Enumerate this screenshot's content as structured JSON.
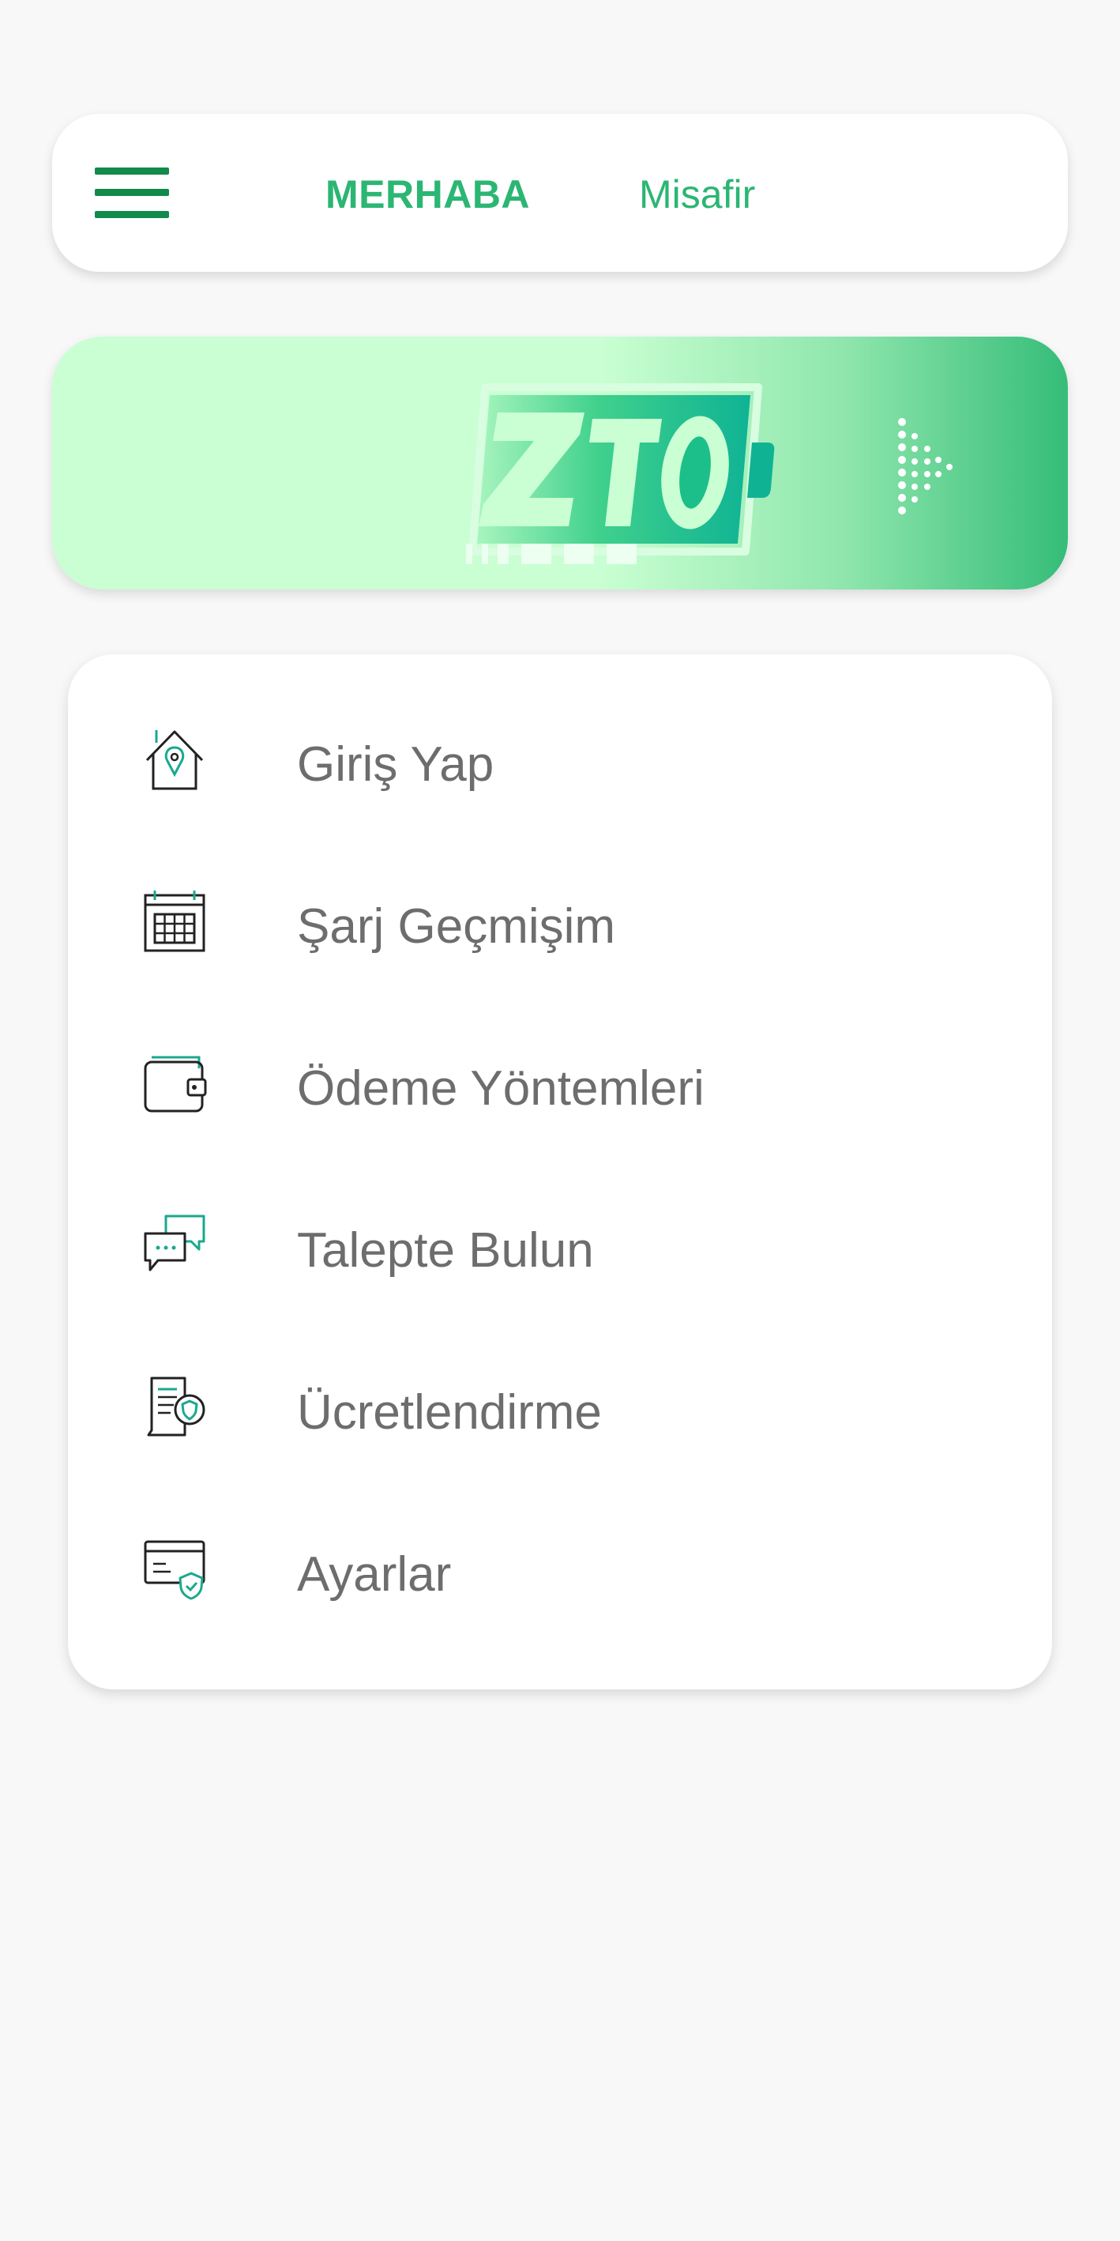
{
  "header": {
    "greeting": "MERHABA",
    "user_name": "Misafir"
  },
  "banner": {
    "logo_icon": "zto-battery-logo",
    "arrow_icon": "dotted-arrow-icon"
  },
  "colors": {
    "accent": "#2bb673",
    "accent_dark": "#118a4a",
    "icon_teal": "#1aa88e",
    "text": "#6d6d6d"
  },
  "menu": {
    "items": [
      {
        "label": "Giriş Yap",
        "icon": "home-location-icon"
      },
      {
        "label": "Şarj Geçmişim",
        "icon": "calendar-icon"
      },
      {
        "label": "Ödeme Yöntemleri",
        "icon": "wallet-icon"
      },
      {
        "label": "Talepte Bulun",
        "icon": "chat-bubbles-icon"
      },
      {
        "label": "Ücretlendirme",
        "icon": "document-shield-icon"
      },
      {
        "label": "Ayarlar",
        "icon": "card-shield-icon"
      }
    ]
  }
}
